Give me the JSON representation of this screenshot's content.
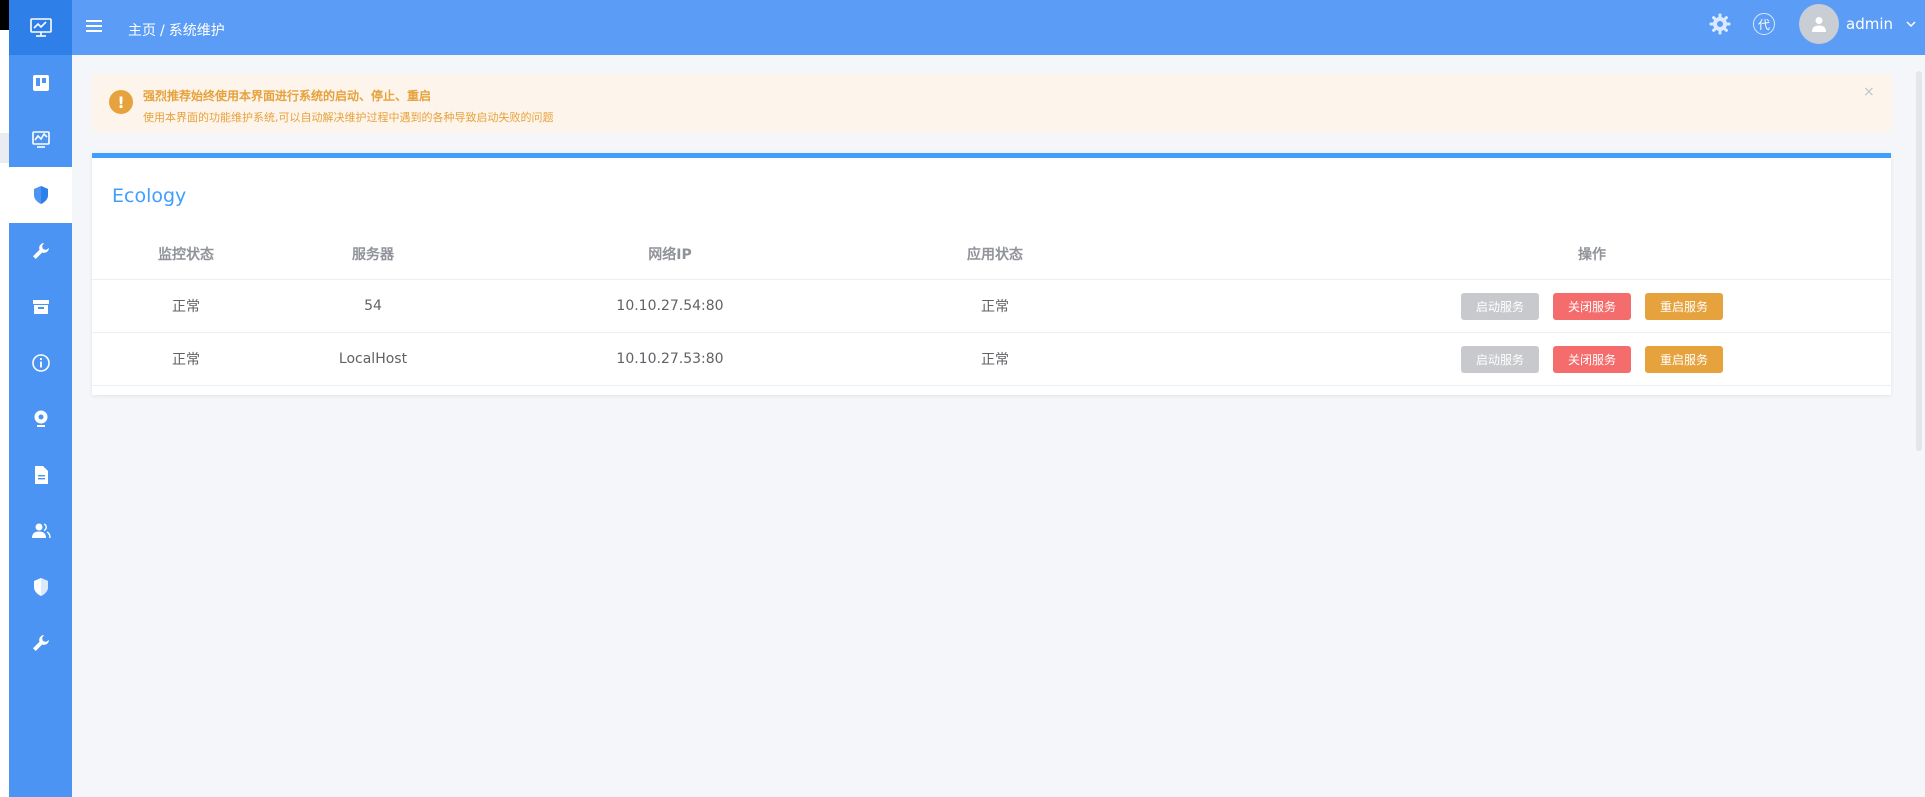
{
  "header": {
    "breadcrumb_home": "主页",
    "breadcrumb_separator": "/",
    "breadcrumb_current": "系统维护",
    "proxy_label": "代",
    "username": "admin"
  },
  "alert": {
    "title": "强烈推荐始终使用本界面进行系统的启动、停止、重启",
    "description": "使用本界面的功能维护系统,可以自动解决维护过程中遇到的各种导致启动失败的问题",
    "close_glyph": "×"
  },
  "panel": {
    "title": "Ecology",
    "columns": [
      "监控状态",
      "服务器",
      "网络IP",
      "应用状态",
      "操作"
    ],
    "rows": [
      {
        "monitor": "正常",
        "server": "54",
        "ip": "10.10.27.54:80",
        "app_status": "正常"
      },
      {
        "monitor": "正常",
        "server": "LocalHost",
        "ip": "10.10.27.53:80",
        "app_status": "正常"
      }
    ],
    "actions": {
      "start": "启动服务",
      "stop": "关闭服务",
      "restart": "重启服务"
    }
  },
  "sidebar": {
    "items": [
      "monitor-icon",
      "board-icon",
      "chart-icon",
      "shield-icon",
      "wrench-icon",
      "archive-icon",
      "info-icon",
      "webcam-icon",
      "document-icon",
      "users-icon",
      "shield-icon",
      "wrench-icon"
    ],
    "active_index": 3
  },
  "colors": {
    "sidebar": "#4b94f4",
    "topbar": "#5a9cf6",
    "accent": "#409eff",
    "warning": "#e6a23c",
    "danger": "#f56c6c",
    "disabled": "#c8c9cc"
  }
}
